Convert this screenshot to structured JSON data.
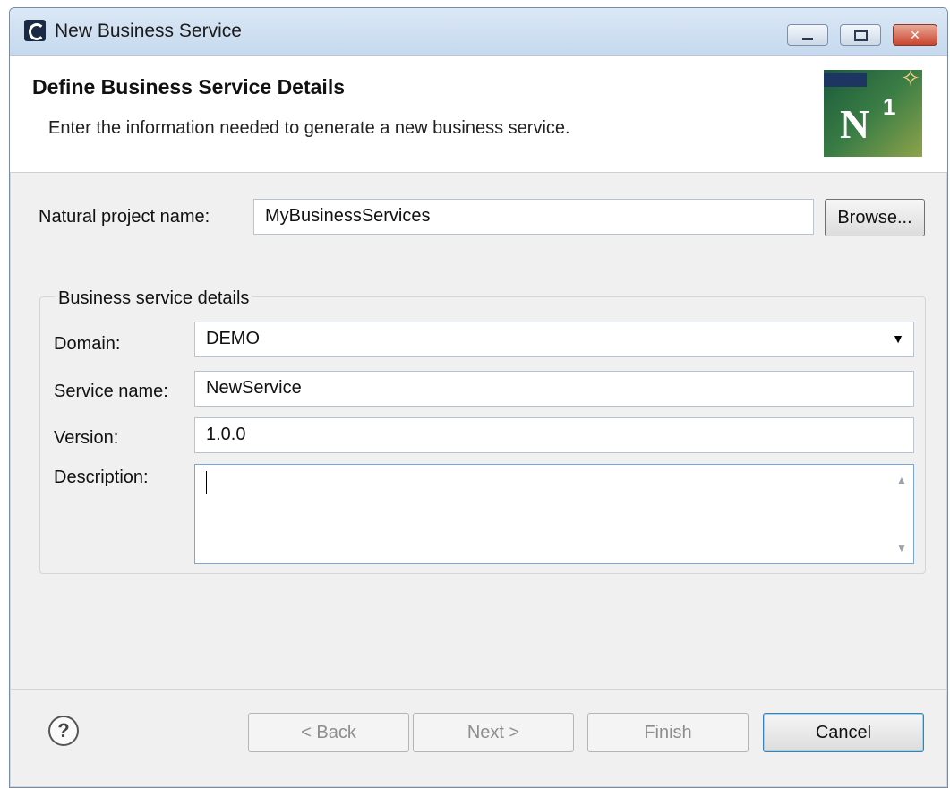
{
  "window": {
    "title": "New Business Service",
    "controls": {
      "minimize": "minimize-icon",
      "maximize": "maximize-icon",
      "close": "close-icon"
    }
  },
  "header": {
    "title": "Define Business Service Details",
    "description": "Enter the information needed to generate a new business service.",
    "logo": {
      "text": "N",
      "superscript": "1",
      "icon": "natural-one-logo"
    }
  },
  "project": {
    "label": "Natural project name:",
    "value": "MyBusinessServices",
    "browse_label": "Browse..."
  },
  "details": {
    "legend": "Business service details",
    "domain": {
      "label": "Domain:",
      "value": "DEMO"
    },
    "service_name": {
      "label": "Service name:",
      "value": "NewService"
    },
    "version": {
      "label": "Version:",
      "value": "1.0.0"
    },
    "description": {
      "label": "Description:",
      "value": ""
    }
  },
  "footer": {
    "help_glyph": "?",
    "back_label": "< Back",
    "next_label": "Next >",
    "finish_label": "Finish",
    "cancel_label": "Cancel"
  }
}
